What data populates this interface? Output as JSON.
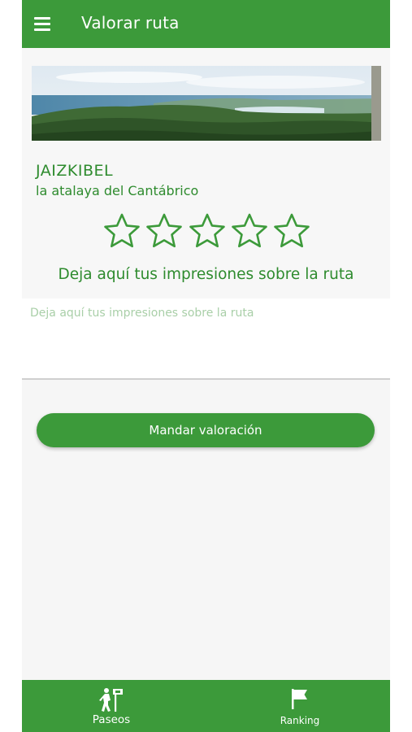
{
  "app_bar": {
    "title": "Valorar ruta",
    "menu_icon": "hamburger-menu-icon"
  },
  "route": {
    "name": "JAIZKIBEL",
    "subtitle": "la atalaya del Cantábrico",
    "image_description_icon": "landscape-image"
  },
  "rating": {
    "max_stars": 5,
    "selected": 0,
    "star_icon": "star-outline-icon"
  },
  "review": {
    "prompt": "Deja aquí tus impresiones sobre la ruta",
    "placeholder": "Deja aquí tus impresiones sobre la ruta",
    "value": ""
  },
  "submit": {
    "label": "Mandar valoración"
  },
  "bottom_nav": {
    "items": [
      {
        "label": "Paseos",
        "icon": "hiker-signpost-icon"
      },
      {
        "label": "Ranking",
        "icon": "flag-icon"
      }
    ]
  },
  "colors": {
    "primary": "#3c9a3a",
    "text_green": "#2e8b2e",
    "placeholder": "#a9cfa8",
    "background": "#f6f6f6"
  }
}
